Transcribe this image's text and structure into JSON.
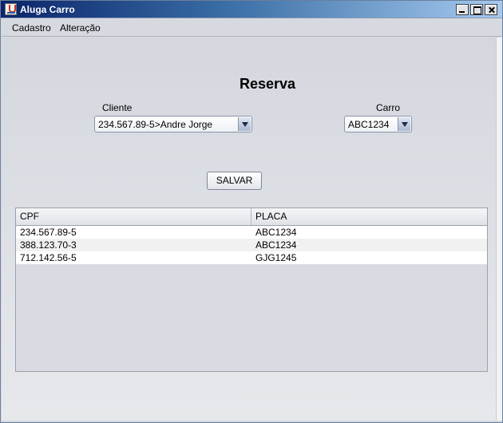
{
  "window": {
    "title": "Aluga Carro"
  },
  "menu": {
    "items": [
      "Cadastro",
      "Alteração"
    ]
  },
  "form": {
    "heading": "Reserva",
    "cliente_label": "Cliente",
    "cliente_value": "234.567.89-5>Andre Jorge",
    "carro_label": "Carro",
    "carro_value": "ABC1234",
    "save_label": "SALVAR"
  },
  "table": {
    "headers": [
      "CPF",
      "PLACA"
    ],
    "rows": [
      [
        "234.567.89-5",
        "ABC1234"
      ],
      [
        "388.123.70-3",
        "ABC1234"
      ],
      [
        "712.142.56-5",
        "GJG1245"
      ]
    ]
  },
  "colors": {
    "titlebar_start": "#0a246a",
    "titlebar_end": "#a6caf0",
    "panel_bg": "#d6d9df"
  },
  "icons": [
    "java-app-icon",
    "minimize-icon",
    "maximize-icon",
    "close-icon",
    "dropdown-arrow-icon"
  ]
}
